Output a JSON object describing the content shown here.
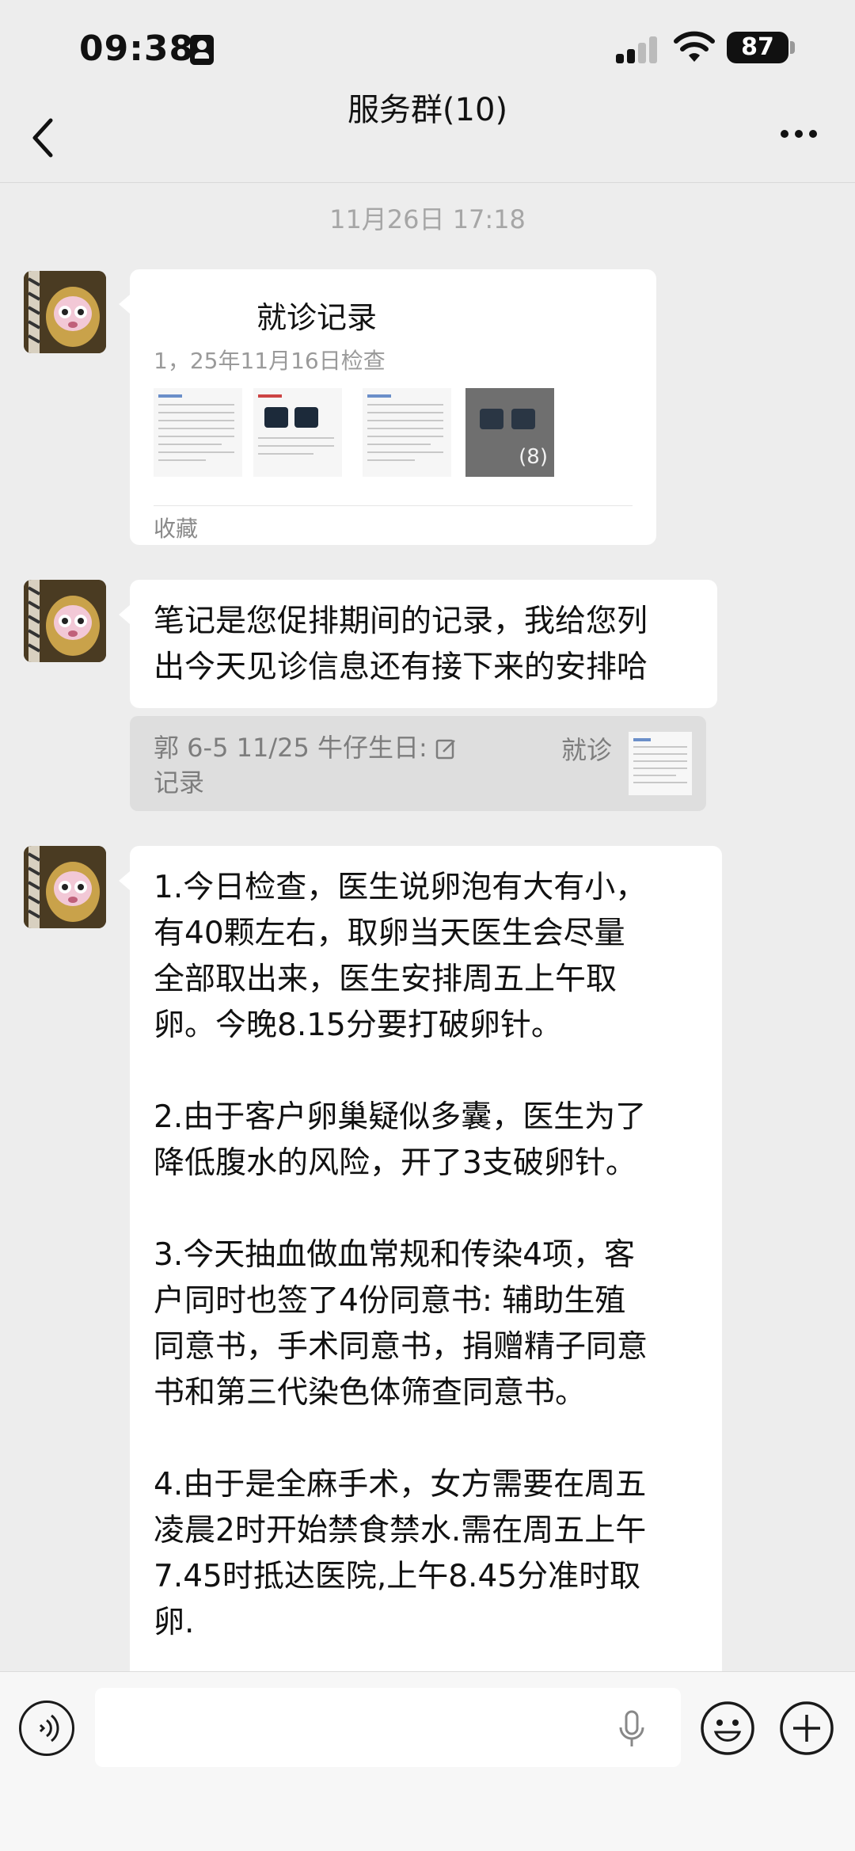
{
  "status": {
    "time": "09:38",
    "battery": "87"
  },
  "nav": {
    "title": "服务群(10)"
  },
  "chat": {
    "timestamp": "11月26日 17:18",
    "card": {
      "title": "就诊记录",
      "subtitle": "1，25年11月16日检查",
      "more_count": "(8)",
      "footer": "收藏"
    },
    "message1": "笔记是您促排期间的记录，我给您列\n出今天见诊信息还有接下来的安排哈",
    "quote": {
      "line1": "郭 6-5 11/25 牛仔生日:",
      "line2": "记录",
      "tail": "就诊"
    },
    "message2": "1.今日检查，医生说卵泡有大有小，\n有40颗左右，取卵当天医生会尽量\n全部取出来，医生安排周五上午取\n卵。今晚8.15分要打破卵针。\n\n2.由于客户卵巢疑似多囊，医生为了\n降低腹水的风险，开了3支破卵针。\n\n3.今天抽血做血常规和传染4项，客\n户同时也签了4份同意书: 辅助生殖\n同意书，手术同意书，捐赠精子同意\n书和第三代染色体筛查同意书。\n\n4.由于是全麻手术，女方需要在周五\n凌晨2时开始禁食禁水.需在周五上午\n7.45时抵达医院,上午8.45分准时取\n卵."
  },
  "icons": {
    "back": "chevron-left-icon",
    "more": "more-dots-icon",
    "voice": "voice-icon",
    "mic": "microphone-icon",
    "emoji": "emoji-icon",
    "plus": "plus-icon"
  }
}
